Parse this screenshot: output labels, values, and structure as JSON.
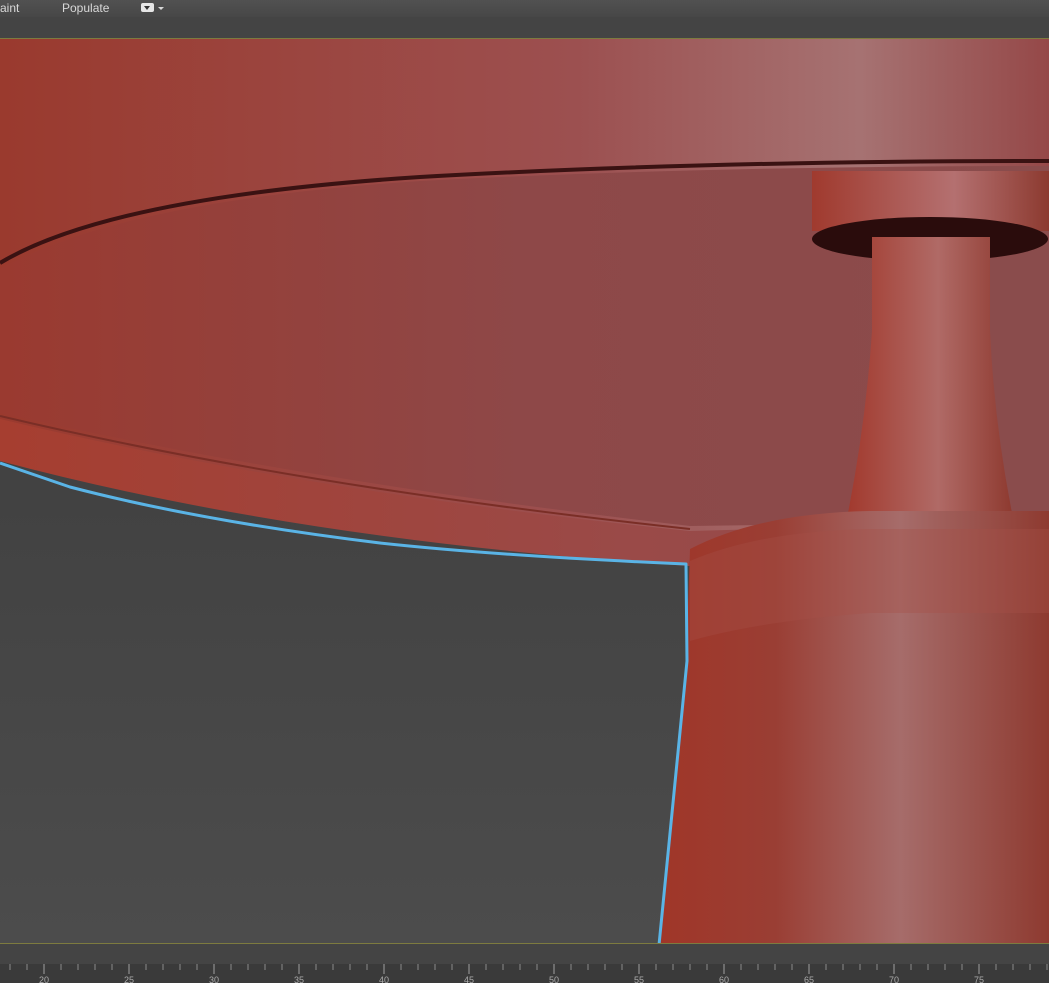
{
  "menubar": {
    "items": [
      {
        "label": "aint"
      },
      {
        "label": "Populate"
      }
    ]
  },
  "timeline": {
    "ticks": [
      "20",
      "25",
      "30",
      "35",
      "40",
      "45",
      "50",
      "55",
      "60",
      "65",
      "70",
      "75"
    ]
  },
  "colors": {
    "viewport_background": "#3a3a3a",
    "model": "#9e4034",
    "selection_outline": "#5ab4e6",
    "viewport_border": "#7d7b3f"
  }
}
